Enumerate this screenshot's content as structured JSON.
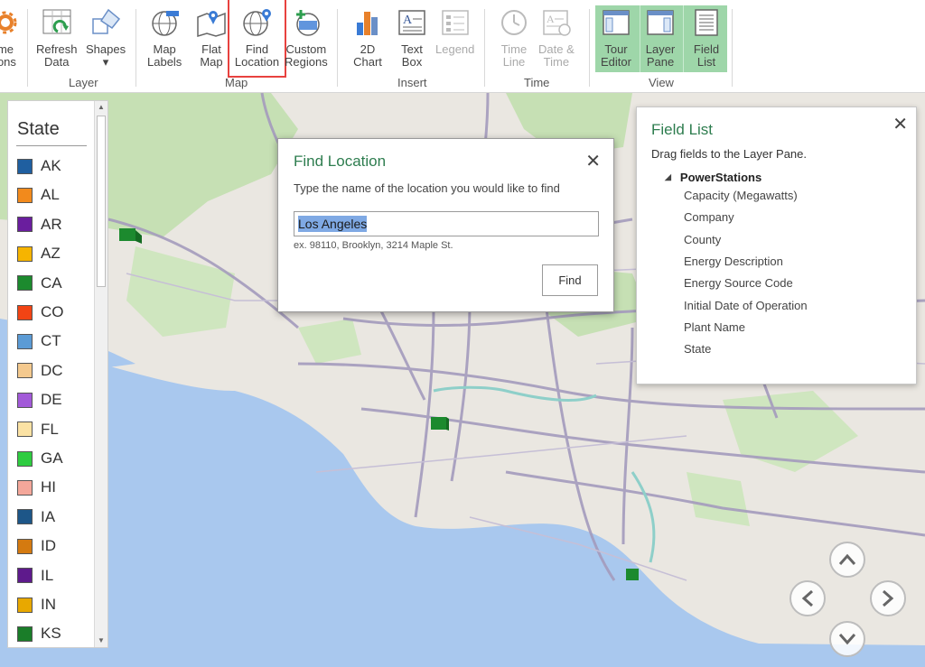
{
  "ribbon": {
    "buttons": [
      {
        "label": "me\nions",
        "name": "themes-options-button",
        "icon": "gear-icon"
      },
      {
        "label": "Refresh\nData",
        "name": "refresh-data-button",
        "icon": "refresh-data-icon"
      },
      {
        "label": "Shapes\n▾",
        "name": "shapes-button",
        "icon": "shapes-icon"
      },
      {
        "label": "Map\nLabels",
        "name": "map-labels-button",
        "icon": "map-labels-icon"
      },
      {
        "label": "Flat\nMap",
        "name": "flat-map-button",
        "icon": "flat-map-icon"
      },
      {
        "label": "Find\nLocation",
        "name": "find-location-button",
        "icon": "globe-pin-icon"
      },
      {
        "label": "Custom\nRegions",
        "name": "custom-regions-button",
        "icon": "custom-regions-icon"
      },
      {
        "label": "2D\nChart",
        "name": "2d-chart-button",
        "icon": "bar-chart-icon"
      },
      {
        "label": "Text\nBox",
        "name": "text-box-button",
        "icon": "text-box-icon"
      },
      {
        "label": "Legend",
        "name": "legend-button",
        "icon": "legend-icon"
      },
      {
        "label": "Time\nLine",
        "name": "time-line-button",
        "icon": "clock-icon"
      },
      {
        "label": "Date &\nTime",
        "name": "date-time-button",
        "icon": "date-time-icon"
      },
      {
        "label": "Tour\nEditor",
        "name": "tour-editor-button",
        "icon": "tour-editor-icon"
      },
      {
        "label": "Layer\nPane",
        "name": "layer-pane-button",
        "icon": "layer-pane-icon"
      },
      {
        "label": "Field\nList",
        "name": "field-list-button",
        "icon": "field-list-icon"
      }
    ],
    "groups": {
      "layer": "Layer",
      "map": "Map",
      "insert": "Insert",
      "time": "Time",
      "view": "View"
    }
  },
  "legend": {
    "title": "State",
    "items": [
      {
        "label": "AK",
        "color": "#1f5fa0"
      },
      {
        "label": "AL",
        "color": "#f28a1c"
      },
      {
        "label": "AR",
        "color": "#6a1e9e"
      },
      {
        "label": "AZ",
        "color": "#f6b400"
      },
      {
        "label": "CA",
        "color": "#1c8a2e"
      },
      {
        "label": "CO",
        "color": "#f24414"
      },
      {
        "label": "CT",
        "color": "#5b9bd5"
      },
      {
        "label": "DC",
        "color": "#f4c98e"
      },
      {
        "label": "DE",
        "color": "#a25ad8"
      },
      {
        "label": "FL",
        "color": "#fbe2a4"
      },
      {
        "label": "GA",
        "color": "#2ecc40"
      },
      {
        "label": "HI",
        "color": "#f4a79a"
      },
      {
        "label": "IA",
        "color": "#1d5688"
      },
      {
        "label": "ID",
        "color": "#d47a10"
      },
      {
        "label": "IL",
        "color": "#5e1a8c"
      },
      {
        "label": "IN",
        "color": "#e8a800"
      },
      {
        "label": "KS",
        "color": "#1a7d29"
      }
    ]
  },
  "dialog": {
    "title": "Find Location",
    "close": "✕",
    "prompt": "Type the name of the location you would like to find",
    "input_value": "Los Angeles",
    "hint": "ex. 98110, Brooklyn, 3214 Maple St.",
    "find_label": "Find"
  },
  "fieldlist": {
    "title": "Field List",
    "close": "✕",
    "description": "Drag fields to the Layer Pane.",
    "group": "PowerStations",
    "fields": [
      "Capacity (Megawatts)",
      "Company",
      "County",
      "Energy Description",
      "Energy Source Code",
      "Initial Date of Operation",
      "Plant Name",
      "State"
    ]
  },
  "nav": {
    "up": "⌃",
    "left": "‹",
    "right": "›",
    "down": "⌄"
  },
  "colors": {
    "accent_green": "#2e7d4f",
    "view_group_bg": "#9ed6a9",
    "highlight_red": "#e8423f",
    "water": "#a9c8ee",
    "land": "#eae7e1",
    "park": "#c6e0b4",
    "road": "#a49bbd"
  }
}
